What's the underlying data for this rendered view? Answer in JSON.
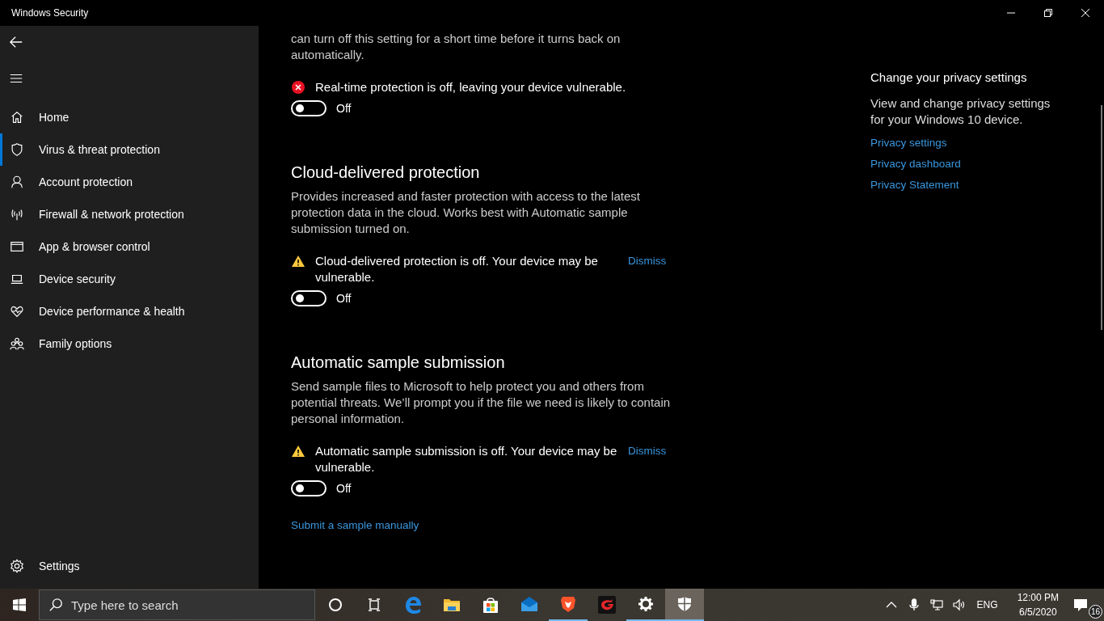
{
  "window": {
    "title": "Windows Security"
  },
  "sidebar": {
    "items": [
      {
        "label": "Home",
        "kind": "home",
        "selected": false
      },
      {
        "label": "Virus & threat protection",
        "kind": "shield",
        "selected": true
      },
      {
        "label": "Account protection",
        "kind": "person",
        "selected": false
      },
      {
        "label": "Firewall & network protection",
        "kind": "antenna",
        "selected": false
      },
      {
        "label": "App & browser control",
        "kind": "window",
        "selected": false
      },
      {
        "label": "Device security",
        "kind": "laptop",
        "selected": false
      },
      {
        "label": "Device performance & health",
        "kind": "heart",
        "selected": false
      },
      {
        "label": "Family options",
        "kind": "family",
        "selected": false
      }
    ],
    "settings": {
      "label": "Settings"
    }
  },
  "sections": [
    {
      "description": "can turn off this setting for a short time before it turns back on automatically.",
      "alert": {
        "kind": "error",
        "text": "Real-time protection is off, leaving your device vulnerable."
      },
      "toggle": {
        "on": false,
        "label": "Off"
      }
    },
    {
      "title": "Cloud-delivered protection",
      "description": "Provides increased and faster protection with access to the latest protection data in the cloud. Works best with Automatic sample submission turned on.",
      "alert": {
        "kind": "warning",
        "text": "Cloud-delivered protection is off. Your device may be vulnerable.",
        "dismiss": "Dismiss"
      },
      "toggle": {
        "on": false,
        "label": "Off"
      }
    },
    {
      "title": "Automatic sample submission",
      "description": "Send sample files to Microsoft to help protect you and others from potential threats. We’ll prompt you if the file we need is likely to contain personal information.",
      "alert": {
        "kind": "warning",
        "text": "Automatic sample submission is off. Your device may be vulnerable.",
        "dismiss": "Dismiss"
      },
      "toggle": {
        "on": false,
        "label": "Off"
      },
      "link": "Submit a sample manually"
    }
  ],
  "privacy": {
    "title": "Change your privacy settings",
    "description": "View and change privacy settings for your Windows 10 device.",
    "links": [
      "Privacy settings",
      "Privacy dashboard",
      "Privacy Statement"
    ]
  },
  "taskbar": {
    "search": {
      "placeholder": "Type here to search"
    },
    "apps": [
      {
        "kind": "cortana",
        "running": false,
        "selected": false
      },
      {
        "kind": "taskview",
        "running": false,
        "selected": false
      },
      {
        "kind": "edge",
        "running": false,
        "selected": false
      },
      {
        "kind": "folder",
        "running": false,
        "selected": false
      },
      {
        "kind": "store",
        "running": false,
        "selected": false
      },
      {
        "kind": "mail",
        "running": false,
        "selected": false
      },
      {
        "kind": "brave",
        "running": true,
        "selected": false
      },
      {
        "kind": "garena",
        "running": false,
        "selected": false
      },
      {
        "kind": "gear",
        "running": true,
        "selected": false
      },
      {
        "kind": "security",
        "running": true,
        "selected": true
      }
    ],
    "language": "ENG",
    "time": "12:00 PM",
    "date": "6/5/2020",
    "notifications": "16"
  }
}
